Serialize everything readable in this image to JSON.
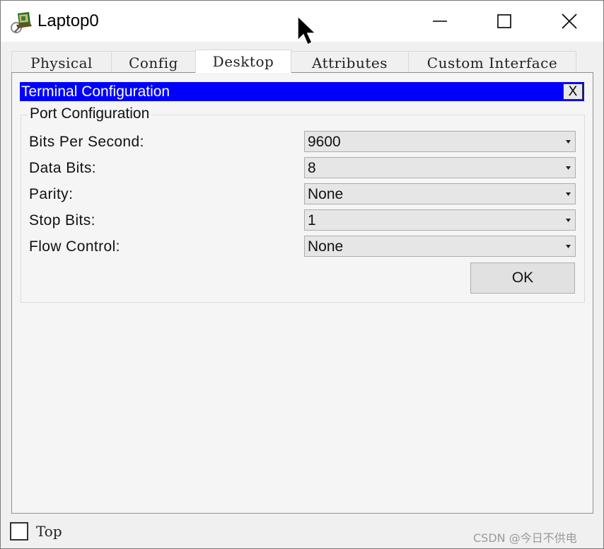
{
  "window": {
    "title": "Laptop0",
    "icon": "laptop-app-icon",
    "controls": {
      "minimize": "minimize-icon",
      "maximize": "maximize-icon",
      "close": "close-icon"
    }
  },
  "tabs": [
    {
      "label": "Physical",
      "active": false
    },
    {
      "label": "Config",
      "active": false
    },
    {
      "label": "Desktop",
      "active": true
    },
    {
      "label": "Attributes",
      "active": false
    },
    {
      "label": "Custom Interface",
      "active": false
    }
  ],
  "terminal": {
    "title": "Terminal Configuration",
    "close_label": "X",
    "header_color": "#0000ff",
    "group_title": "Port Configuration",
    "fields": [
      {
        "label": "Bits Per Second:",
        "value": "9600"
      },
      {
        "label": "Data Bits:",
        "value": "8"
      },
      {
        "label": "Parity:",
        "value": "None"
      },
      {
        "label": "Stop Bits:",
        "value": "1"
      },
      {
        "label": "Flow Control:",
        "value": "None"
      }
    ],
    "ok_label": "OK"
  },
  "footer": {
    "top_checkbox_label": "Top",
    "top_checked": false,
    "watermark": "CSDN @今日不供电"
  }
}
